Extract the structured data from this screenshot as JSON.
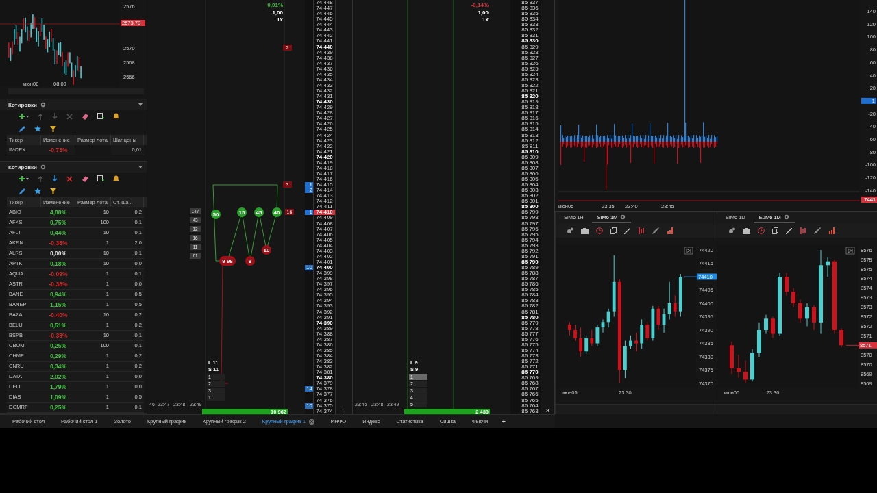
{
  "mini_chart": {
    "axis": [
      {
        "text": "2576",
        "highlight": false
      },
      {
        "text": "2573.79",
        "highlight": true
      },
      {
        "text": "2570",
        "highlight": false
      },
      {
        "text": "2568",
        "highlight": false
      },
      {
        "text": "2566",
        "highlight": false
      }
    ],
    "times": [
      "июн08",
      "08:00"
    ]
  },
  "quote_widgets": [
    {
      "title": "Котировки",
      "row_actions_enabled": false,
      "columns": [
        "Тикер",
        "Изменение",
        "Размер лота",
        "Шаг цены"
      ],
      "rows": [
        {
          "ticker": "IMOEX",
          "change": "-0,73%",
          "color": "#d02a2a",
          "step": "0,01"
        }
      ]
    },
    {
      "title": "Котировки",
      "row_actions_enabled": true,
      "columns": [
        "Тикер",
        "Изменение",
        "Размер лота",
        "Ст. ша..."
      ],
      "rows": [
        {
          "ticker": "ABIO",
          "change": "4,88%",
          "color": "#3fbf3f",
          "lot": "10",
          "step": "0,2"
        },
        {
          "ticker": "AFKS",
          "change": "0,75%",
          "color": "#3fbf3f",
          "lot": "100",
          "step": "0,1"
        },
        {
          "ticker": "AFLT",
          "change": "0,44%",
          "color": "#3fbf3f",
          "lot": "10",
          "step": "0,1"
        },
        {
          "ticker": "AKRN",
          "change": "-0,38%",
          "color": "#d02a2a",
          "lot": "1",
          "step": "2,0"
        },
        {
          "ticker": "ALRS",
          "change": "0,00%",
          "color": "#dddddd",
          "lot": "10",
          "step": "0,1"
        },
        {
          "ticker": "APTK",
          "change": "0,18%",
          "color": "#3fbf3f",
          "lot": "10",
          "step": "0,0"
        },
        {
          "ticker": "AQUA",
          "change": "-0,09%",
          "color": "#d02a2a",
          "lot": "1",
          "step": "0,1"
        },
        {
          "ticker": "ASTR",
          "change": "-0,38%",
          "color": "#d02a2a",
          "lot": "1",
          "step": "0,0"
        },
        {
          "ticker": "BANE",
          "change": "0,94%",
          "color": "#3fbf3f",
          "lot": "1",
          "step": "0,5"
        },
        {
          "ticker": "BANEP",
          "change": "1,15%",
          "color": "#3fbf3f",
          "lot": "1",
          "step": "0,5"
        },
        {
          "ticker": "BAZA",
          "change": "-0,40%",
          "color": "#d02a2a",
          "lot": "10",
          "step": "0,2"
        },
        {
          "ticker": "BELU",
          "change": "0,51%",
          "color": "#3fbf3f",
          "lot": "1",
          "step": "0,2"
        },
        {
          "ticker": "BSPB",
          "change": "-0,38%",
          "color": "#d02a2a",
          "lot": "10",
          "step": "0,1"
        },
        {
          "ticker": "CBOM",
          "change": "0,25%",
          "color": "#3fbf3f",
          "lot": "100",
          "step": "0,1"
        },
        {
          "ticker": "CHMF",
          "change": "0,29%",
          "color": "#3fbf3f",
          "lot": "1",
          "step": "0,2"
        },
        {
          "ticker": "CNRU",
          "change": "0,34%",
          "color": "#3fbf3f",
          "lot": "1",
          "step": "0,2"
        },
        {
          "ticker": "DATA",
          "change": "2,02%",
          "color": "#3fbf3f",
          "lot": "1",
          "step": "0,0"
        },
        {
          "ticker": "DELI",
          "change": "1,79%",
          "color": "#3fbf3f",
          "lot": "1",
          "step": "0,0"
        },
        {
          "ticker": "DIAS",
          "change": "1,09%",
          "color": "#3fbf3f",
          "lot": "1",
          "step": "0,5"
        },
        {
          "ticker": "DOMRF",
          "change": "0,25%",
          "color": "#3fbf3f",
          "lot": "1",
          "step": "0,1"
        }
      ]
    }
  ],
  "dom_panels": [
    {
      "change": "0,01%",
      "color": "#3fbf3f",
      "multiplier": "1,00",
      "zoom": "1x",
      "long": "L 11",
      "short": "S 11",
      "positions": [
        {
          "text": "1",
          "selected": false
        },
        {
          "text": "2",
          "selected": false
        },
        {
          "text": "3",
          "selected": false
        },
        {
          "text": "1",
          "selected": false
        }
      ],
      "volume_total": "10 962",
      "times": [
        "46",
        "23:47",
        "23:48",
        "23:49"
      ],
      "side_label": "0",
      "bubbles": [
        {
          "label": "50",
          "kind": "buy"
        },
        {
          "label": "15",
          "kind": "buy"
        },
        {
          "label": "45",
          "kind": "buy"
        },
        {
          "label": "40",
          "kind": "buy"
        },
        {
          "label": "9 96",
          "kind": "sell"
        },
        {
          "label": "8",
          "kind": "sell"
        },
        {
          "label": "10",
          "kind": "sell"
        }
      ],
      "tags": [
        {
          "text": "2",
          "kind": "sell"
        },
        {
          "text": "3",
          "kind": "sell"
        },
        {
          "text": "16",
          "kind": "sell"
        }
      ],
      "profile": [
        "147",
        "43",
        "12",
        "16",
        "11",
        "61"
      ],
      "ladder": [
        {
          "price": "74 448",
          "bold": false
        },
        {
          "price": "74 447",
          "bold": false
        },
        {
          "price": "74 446",
          "bold": false
        },
        {
          "price": "74 445",
          "bold": false
        },
        {
          "price": "74 444",
          "bold": false
        },
        {
          "price": "74 443",
          "bold": false
        },
        {
          "price": "74 442",
          "bold": false
        },
        {
          "price": "74 441",
          "bold": false
        },
        {
          "price": "74 440",
          "bold": true
        },
        {
          "price": "74 439",
          "bold": false
        },
        {
          "price": "74 438",
          "bold": false
        },
        {
          "price": "74 437",
          "bold": false
        },
        {
          "price": "74 436",
          "bold": false
        },
        {
          "price": "74 435",
          "bold": false
        },
        {
          "price": "74 434",
          "bold": false
        },
        {
          "price": "74 433",
          "bold": false
        },
        {
          "price": "74 432",
          "bold": false
        },
        {
          "price": "74 431",
          "bold": false
        },
        {
          "price": "74 430",
          "bold": true
        },
        {
          "price": "74 429",
          "bold": false
        },
        {
          "price": "74 428",
          "bold": false
        },
        {
          "price": "74 427",
          "bold": false
        },
        {
          "price": "74 426",
          "bold": false
        },
        {
          "price": "74 425",
          "bold": false
        },
        {
          "price": "74 424",
          "bold": false
        },
        {
          "price": "74 423",
          "bold": false
        },
        {
          "price": "74 422",
          "bold": false
        },
        {
          "price": "74 421",
          "bold": false
        },
        {
          "price": "74 420",
          "bold": true
        },
        {
          "price": "74 419",
          "bold": false
        },
        {
          "price": "74 418",
          "bold": false
        },
        {
          "price": "74 417",
          "bold": false
        },
        {
          "price": "74 416",
          "bold": false
        },
        {
          "price": "74 415",
          "bold": false,
          "volume": "1",
          "kind": "bid"
        },
        {
          "price": "74 414",
          "bold": false,
          "volume": "2",
          "kind": "bid"
        },
        {
          "price": "74 413",
          "bold": false
        },
        {
          "price": "74 412",
          "bold": false
        },
        {
          "price": "74 411",
          "bold": false
        },
        {
          "price": "74 410",
          "bold": true,
          "volume": "1",
          "kind": "ask"
        },
        {
          "price": "74 409",
          "bold": false
        },
        {
          "price": "74 408",
          "bold": false
        },
        {
          "price": "74 407",
          "bold": false
        },
        {
          "price": "74 406",
          "bold": false
        },
        {
          "price": "74 405",
          "bold": false
        },
        {
          "price": "74 404",
          "bold": false
        },
        {
          "price": "74 403",
          "bold": false
        },
        {
          "price": "74 402",
          "bold": false
        },
        {
          "price": "74 401",
          "bold": false
        },
        {
          "price": "74 400",
          "bold": true,
          "volume": "10",
          "kind": "bid"
        },
        {
          "price": "74 399",
          "bold": false
        },
        {
          "price": "74 398",
          "bold": false
        },
        {
          "price": "74 397",
          "bold": false
        },
        {
          "price": "74 396",
          "bold": false
        },
        {
          "price": "74 395",
          "bold": false
        },
        {
          "price": "74 394",
          "bold": false
        },
        {
          "price": "74 393",
          "bold": false
        },
        {
          "price": "74 392",
          "bold": false
        },
        {
          "price": "74 391",
          "bold": false
        },
        {
          "price": "74 390",
          "bold": true
        },
        {
          "price": "74 389",
          "bold": false
        },
        {
          "price": "74 388",
          "bold": false
        },
        {
          "price": "74 387",
          "bold": false
        },
        {
          "price": "74 386",
          "bold": false
        },
        {
          "price": "74 385",
          "bold": false
        },
        {
          "price": "74 384",
          "bold": false
        },
        {
          "price": "74 383",
          "bold": false
        },
        {
          "price": "74 382",
          "bold": false
        },
        {
          "price": "74 381",
          "bold": false
        },
        {
          "price": "74 380",
          "bold": true
        },
        {
          "price": "74 379",
          "bold": false
        },
        {
          "price": "74 378",
          "bold": false,
          "volume": "14",
          "kind": "bid"
        },
        {
          "price": "74 377",
          "bold": false
        },
        {
          "price": "74 376",
          "bold": false
        },
        {
          "price": "74 375",
          "bold": false,
          "volume": "10",
          "kind": "bid"
        },
        {
          "price": "74 374",
          "bold": false
        }
      ]
    },
    {
      "change": "-0,14%",
      "color": "#e0303a",
      "multiplier": "1,00",
      "zoom": "1x",
      "long": "L 9",
      "short": "S 9",
      "positions": [
        {
          "text": "1",
          "selected": true
        },
        {
          "text": "2",
          "selected": false
        },
        {
          "text": "3",
          "selected": false
        },
        {
          "text": "4",
          "selected": false
        },
        {
          "text": "5",
          "selected": false
        }
      ],
      "volume_total": "2 430",
      "times": [
        "23:46",
        "23:48",
        "23:49"
      ],
      "side_label": "8",
      "ladder": [
        {
          "price": "85 837",
          "bold": false
        },
        {
          "price": "85 836",
          "bold": false
        },
        {
          "price": "85 835",
          "bold": false
        },
        {
          "price": "85 834",
          "bold": false
        },
        {
          "price": "85 833",
          "bold": false
        },
        {
          "price": "85 832",
          "bold": false
        },
        {
          "price": "85 831",
          "bold": false
        },
        {
          "price": "85 830",
          "bold": true
        },
        {
          "price": "85 829",
          "bold": false
        },
        {
          "price": "85 828",
          "bold": false
        },
        {
          "price": "85 827",
          "bold": false
        },
        {
          "price": "85 826",
          "bold": false
        },
        {
          "price": "85 825",
          "bold": false
        },
        {
          "price": "85 824",
          "bold": false
        },
        {
          "price": "85 823",
          "bold": false
        },
        {
          "price": "85 822",
          "bold": false
        },
        {
          "price": "85 821",
          "bold": false
        },
        {
          "price": "85 820",
          "bold": true
        },
        {
          "price": "85 819",
          "bold": false
        },
        {
          "price": "85 818",
          "bold": false
        },
        {
          "price": "85 817",
          "bold": false
        },
        {
          "price": "85 816",
          "bold": false
        },
        {
          "price": "85 815",
          "bold": false
        },
        {
          "price": "85 814",
          "bold": false
        },
        {
          "price": "85 813",
          "bold": false
        },
        {
          "price": "85 812",
          "bold": false
        },
        {
          "price": "85 811",
          "bold": false
        },
        {
          "price": "85 810",
          "bold": true
        },
        {
          "price": "85 809",
          "bold": false
        },
        {
          "price": "85 808",
          "bold": false
        },
        {
          "price": "85 807",
          "bold": false
        },
        {
          "price": "85 806",
          "bold": false
        },
        {
          "price": "85 805",
          "bold": false
        },
        {
          "price": "85 804",
          "bold": false
        },
        {
          "price": "85 803",
          "bold": false
        },
        {
          "price": "85 802",
          "bold": false
        },
        {
          "price": "85 801",
          "bold": false
        },
        {
          "price": "85 800",
          "bold": true
        },
        {
          "price": "85 799",
          "bold": false
        },
        {
          "price": "85 798",
          "bold": false
        },
        {
          "price": "85 797",
          "bold": false
        },
        {
          "price": "85 796",
          "bold": false
        },
        {
          "price": "85 795",
          "bold": false
        },
        {
          "price": "85 794",
          "bold": false
        },
        {
          "price": "85 793",
          "bold": false
        },
        {
          "price": "85 792",
          "bold": false
        },
        {
          "price": "85 791",
          "bold": false
        },
        {
          "price": "85 790",
          "bold": true
        },
        {
          "price": "85 789",
          "bold": false
        },
        {
          "price": "85 788",
          "bold": false
        },
        {
          "price": "85 787",
          "bold": false
        },
        {
          "price": "85 786",
          "bold": false
        },
        {
          "price": "85 785",
          "bold": false
        },
        {
          "price": "85 784",
          "bold": false
        },
        {
          "price": "85 783",
          "bold": false
        },
        {
          "price": "85 782",
          "bold": false
        },
        {
          "price": "85 781",
          "bold": false
        },
        {
          "price": "85 780",
          "bold": true
        },
        {
          "price": "85 779",
          "bold": false
        },
        {
          "price": "85 778",
          "bold": false
        },
        {
          "price": "85 777",
          "bold": false
        },
        {
          "price": "85 776",
          "bold": false
        },
        {
          "price": "85 775",
          "bold": false
        },
        {
          "price": "85 774",
          "bold": false
        },
        {
          "price": "85 773",
          "bold": false
        },
        {
          "price": "85 772",
          "bold": false
        },
        {
          "price": "85 771",
          "bold": false
        },
        {
          "price": "85 770",
          "bold": true
        },
        {
          "price": "85 769",
          "bold": false
        },
        {
          "price": "85 768",
          "bold": false
        },
        {
          "price": "85 767",
          "bold": false
        },
        {
          "price": "85 766",
          "bold": false
        },
        {
          "price": "85 765",
          "bold": false
        },
        {
          "price": "85 764",
          "bold": false
        },
        {
          "price": "85 763",
          "bold": false
        }
      ]
    }
  ],
  "volume_chart": {
    "axis": [
      {
        "text": "140",
        "highlight": false
      },
      {
        "text": "120",
        "highlight": false
      },
      {
        "text": "100",
        "highlight": false
      },
      {
        "text": "80",
        "highlight": false
      },
      {
        "text": "60",
        "highlight": false
      },
      {
        "text": "40",
        "highlight": false
      },
      {
        "text": "20",
        "highlight": false
      },
      {
        "text": "1",
        "highlight": true
      },
      {
        "text": "-20",
        "highlight": false
      },
      {
        "text": "-40",
        "highlight": false
      },
      {
        "text": "-60",
        "highlight": false
      },
      {
        "text": "-80",
        "highlight": false
      },
      {
        "text": "-100",
        "highlight": false
      },
      {
        "text": "-120",
        "highlight": false
      },
      {
        "text": "-140",
        "highlight": false
      }
    ],
    "last_price": "7441",
    "times": [
      "июн05",
      "23:35",
      "23:40",
      "23:45"
    ]
  },
  "chart_widgets": [
    {
      "tabs": [
        {
          "label": "SiM6 1H",
          "selected": false
        },
        {
          "label": "SiM6 1M",
          "selected": true
        }
      ],
      "last_price": {
        "text": "74410",
        "color": "#1e88e5"
      },
      "chart_data": {
        "type": "candlestick",
        "ylim": [
          74370,
          74420
        ],
        "categories": [
          "июн05",
          null,
          null,
          null,
          null,
          null,
          null,
          null,
          null,
          null,
          "23:30",
          null,
          null,
          null,
          null,
          null,
          null,
          null,
          null,
          null,
          null
        ],
        "yticks": [
          74420,
          74415,
          74405,
          74400,
          74395,
          74390,
          74385,
          74380,
          74375,
          74370
        ],
        "ohlc": [
          [
            74392,
            74393,
            74388,
            74390
          ],
          [
            74390,
            74392,
            74386,
            74387
          ],
          [
            74387,
            74391,
            74380,
            74382
          ],
          [
            74382,
            74388,
            74381,
            74387
          ],
          [
            74387,
            74390,
            74384,
            74385
          ],
          [
            74385,
            74392,
            74384,
            74391
          ],
          [
            74391,
            74394,
            74389,
            74393
          ],
          [
            74393,
            74398,
            74391,
            74397
          ],
          [
            74397,
            74418,
            74395,
            74408
          ],
          [
            74408,
            74409,
            74370,
            74375
          ],
          [
            74375,
            74386,
            74372,
            74384
          ],
          [
            74384,
            74388,
            74383,
            74386
          ],
          [
            74386,
            74389,
            74382,
            74385
          ],
          [
            74385,
            74394,
            74383,
            74392
          ],
          [
            74392,
            74393,
            74386,
            74387
          ],
          [
            74387,
            74399,
            74386,
            74398
          ],
          [
            74398,
            74399,
            74390,
            74392
          ],
          [
            74392,
            74398,
            74389,
            74396
          ],
          [
            74396,
            74408,
            74394,
            74400
          ],
          [
            74400,
            74403,
            74395,
            74397
          ],
          [
            74397,
            74411,
            74395,
            74410
          ]
        ]
      }
    },
    {
      "tabs": [
        {
          "label": "SiM6 1D",
          "selected": false
        },
        {
          "label": "EuM6 1M",
          "selected": true
        }
      ],
      "last_price": {
        "text": "8571",
        "color": "#d8323c"
      },
      "half_tick_labels": [
        "8575",
        "8574",
        "8573",
        "8572",
        "8571",
        "8570",
        "8569"
      ],
      "chart_data": {
        "type": "candlestick",
        "ylim": [
          8569,
          8576
        ],
        "categories": [
          "июн05",
          null,
          null,
          null,
          null,
          null,
          "23:30",
          null,
          null,
          null,
          null,
          null,
          null,
          null,
          null,
          null,
          null
        ],
        "yticks": [
          8576,
          8575,
          8574,
          8573,
          8572,
          8570,
          8569
        ],
        "ohlc": [
          [
            8571.0,
            8571.2,
            8569.5,
            8569.8
          ],
          [
            8569.8,
            8570.5,
            8569.3,
            8569.6
          ],
          [
            8569.6,
            8570.2,
            8569.0,
            8569.2
          ],
          [
            8569.2,
            8570.8,
            8569.1,
            8570.6
          ],
          [
            8570.6,
            8572.2,
            8570.4,
            8571.8
          ],
          [
            8571.8,
            8572.6,
            8571.6,
            8572.4
          ],
          [
            8572.4,
            8572.5,
            8571.4,
            8571.6
          ],
          [
            8571.6,
            8574.8,
            8571.5,
            8574.6
          ],
          [
            8574.6,
            8574.8,
            8573.6,
            8573.8
          ],
          [
            8573.8,
            8574.0,
            8573.0,
            8573.2
          ],
          [
            8573.2,
            8573.4,
            8572.2,
            8572.4
          ],
          [
            8572.4,
            8573.2,
            8572.0,
            8573.0
          ],
          [
            8573.0,
            8573.1,
            8571.8,
            8572.2
          ],
          [
            8572.2,
            8576.0,
            8571.6,
            8575.2
          ],
          [
            8575.2,
            8575.6,
            8574.6,
            8575.4
          ],
          [
            8575.4,
            8575.5,
            8571.6,
            8571.8
          ],
          [
            8571.8,
            8571.9,
            8570.9,
            8571.0
          ]
        ]
      }
    }
  ],
  "tabs": [
    {
      "label": "Рабочий стол",
      "selected": false
    },
    {
      "label": "Рабочий стол 1",
      "selected": false
    },
    {
      "label": "Золото",
      "selected": false
    },
    {
      "label": "Крупный график",
      "selected": false
    },
    {
      "label": "Крупный график 2",
      "selected": false
    },
    {
      "label": "Крупный график 1",
      "selected": true
    },
    {
      "label": "ИНФО",
      "selected": false
    },
    {
      "label": "Индекс",
      "selected": false
    },
    {
      "label": "Статистика",
      "selected": false
    },
    {
      "label": "Сишка",
      "selected": false
    },
    {
      "label": "Фьючи",
      "selected": false
    }
  ],
  "add_tab": "+"
}
